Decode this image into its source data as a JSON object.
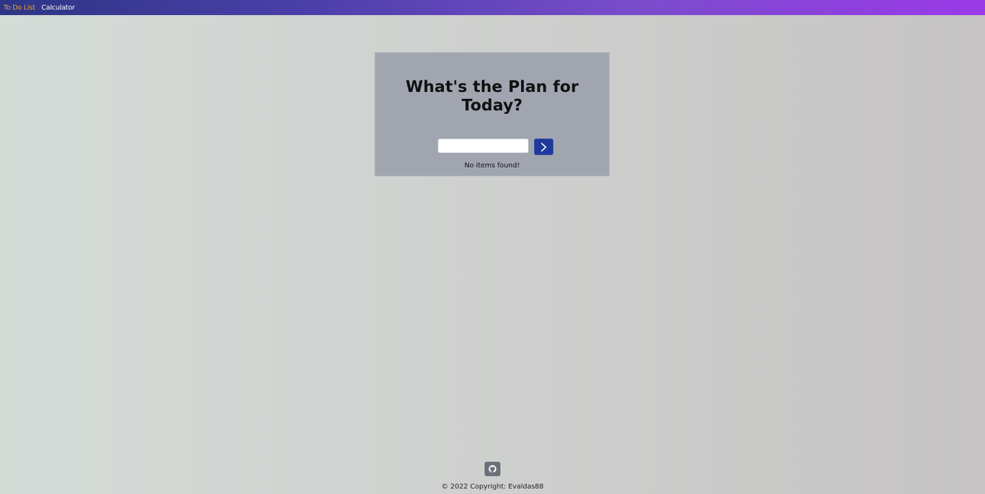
{
  "navbar": {
    "links": [
      {
        "label": "To Do List",
        "active": true
      },
      {
        "label": "Calculator",
        "active": false
      }
    ],
    "active_color": "#f0a23a"
  },
  "card": {
    "title_line1": "What's the Plan for",
    "title_line2": "Today?",
    "input": {
      "value": "",
      "placeholder": ""
    },
    "submit_icon": "chevron-right-icon",
    "empty_message": "No items found!"
  },
  "footer": {
    "github_icon": "github-icon",
    "copyright": "© 2022 Copyright: Evaldas88"
  },
  "colors": {
    "accent": "#1f3a9a",
    "card_bg": "#a0a5b0"
  }
}
